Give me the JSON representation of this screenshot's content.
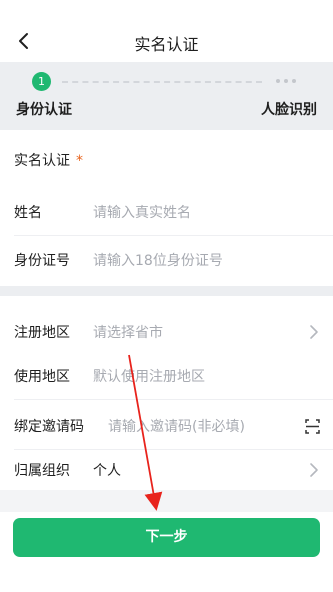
{
  "header": {
    "title": "实名认证",
    "back_icon": "back-arrow-icon"
  },
  "steps": {
    "current_number": "1",
    "step1_label": "身份认证",
    "step2_label": "人脸识别",
    "active_color": "#1fb871"
  },
  "section": {
    "title": "实名认证",
    "required_mark": "*"
  },
  "fields": {
    "name": {
      "label": "姓名",
      "placeholder": "请输入真实姓名"
    },
    "id_number": {
      "label": "身份证号",
      "placeholder": "请输入18位身份证号"
    },
    "register_region": {
      "label": "注册地区",
      "placeholder": "请选择省市"
    },
    "use_region": {
      "label": "使用地区",
      "placeholder": "默认使用注册地区"
    },
    "invite_code": {
      "label": "绑定邀请码",
      "placeholder": "请输入邀请码(非必填)"
    },
    "organization": {
      "label": "归属组织",
      "value": "个人"
    }
  },
  "next_button": {
    "label": "下一步"
  },
  "colors": {
    "accent": "#1fb871",
    "required": "#e8631c",
    "annotation": "#e8231c"
  }
}
